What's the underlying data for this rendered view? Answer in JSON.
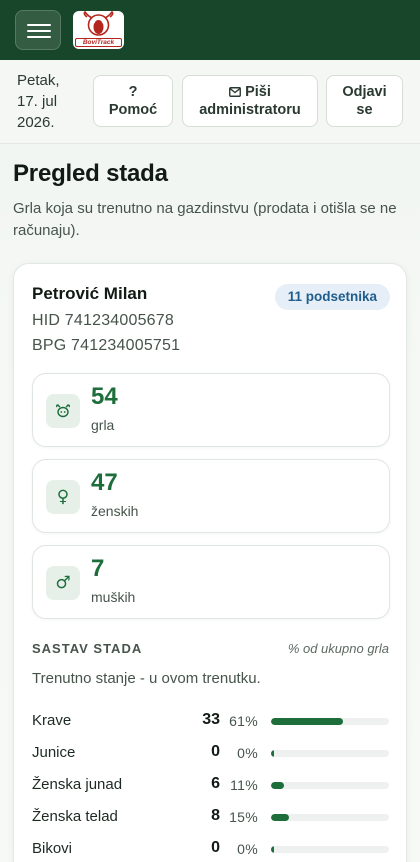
{
  "app": {
    "logo_text": "BoviTrack"
  },
  "header": {
    "date_lines": [
      "Petak,",
      "17. jul",
      "2026."
    ],
    "help_q": "?",
    "help_label": "Pomoć",
    "write_label_1": "Piši",
    "write_label_2": "administratoru",
    "logout_1": "Odjavi",
    "logout_2": "se"
  },
  "page": {
    "title": "Pregled stada",
    "subtitle": "Grla koja su trenutno na gazdinstvu (prodata i otišla se ne računaju)."
  },
  "farm": {
    "owner": "Petrović Milan",
    "reminders": "11 podsetnika",
    "hid": "HID 741234005678",
    "bpg": "BPG 741234005751"
  },
  "stats": [
    {
      "value": "54",
      "label": "grla",
      "icon": "cow-head-icon"
    },
    {
      "value": "47",
      "label": "ženskih",
      "icon": "female-icon"
    },
    {
      "value": "7",
      "label": "muških",
      "icon": "male-icon"
    }
  ],
  "composition": {
    "title": "SASTAV STADA",
    "note": "% od ukupno grla",
    "description": "Trenutno stanje - u ovom trenutku.",
    "rows": [
      {
        "name": "Krave",
        "count": "33",
        "percent": "61%",
        "share": 0.61
      },
      {
        "name": "Junice",
        "count": "0",
        "percent": "0%",
        "share": 0.0
      },
      {
        "name": "Ženska junad",
        "count": "6",
        "percent": "11%",
        "share": 0.11
      },
      {
        "name": "Ženska telad",
        "count": "8",
        "percent": "15%",
        "share": 0.15
      },
      {
        "name": "Bikovi",
        "count": "0",
        "percent": "0%",
        "share": 0.0
      }
    ]
  },
  "colors": {
    "brand": "#17462a",
    "accent": "#1e6e3c"
  }
}
